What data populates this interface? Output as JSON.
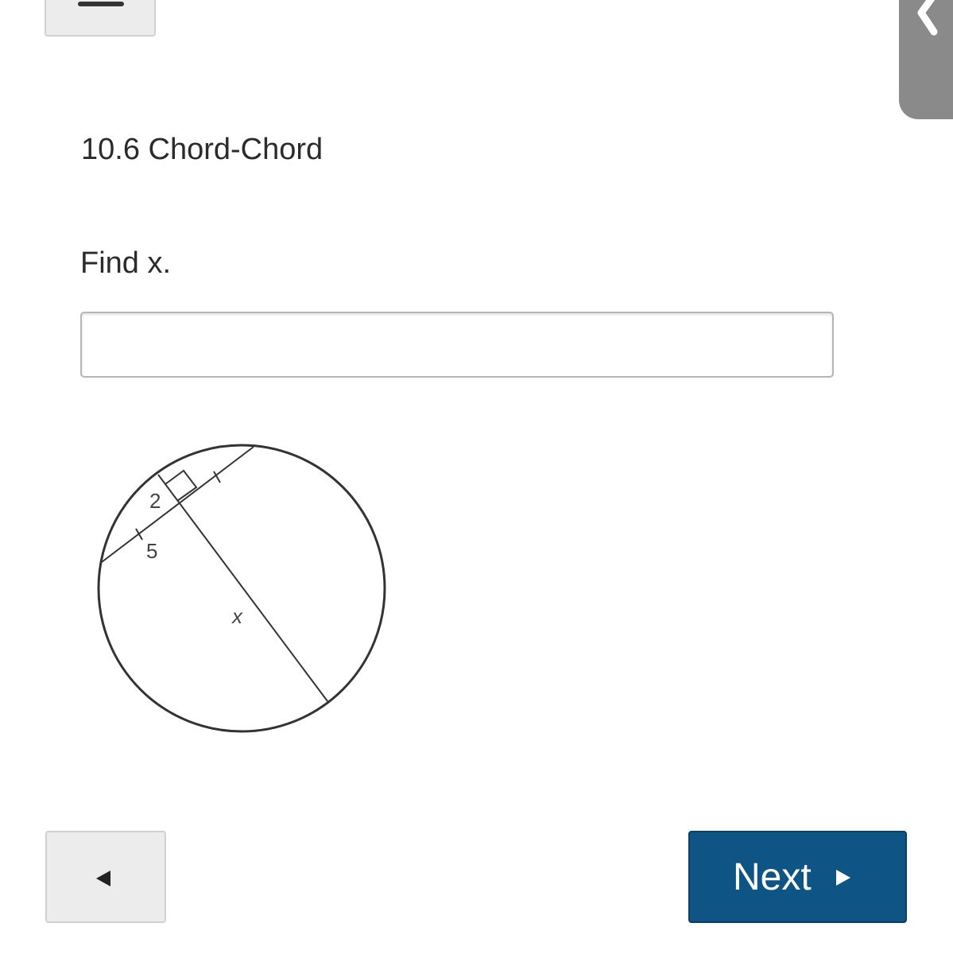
{
  "header": {
    "menu_icon": "menu-bar-icon",
    "side_tab_icon": "chevron-left-icon"
  },
  "question": {
    "section_title": "10.6 Chord-Chord",
    "prompt": "Find x.",
    "answer": {
      "value": "",
      "placeholder": ""
    }
  },
  "figure": {
    "labels": {
      "segment_a": "2",
      "segment_b": "5",
      "segment_x": "x"
    }
  },
  "navigation": {
    "back_icon": "triangle-left-icon",
    "next_label": "Next",
    "next_icon": "triangle-right-icon",
    "next_color": "#0e5485"
  }
}
